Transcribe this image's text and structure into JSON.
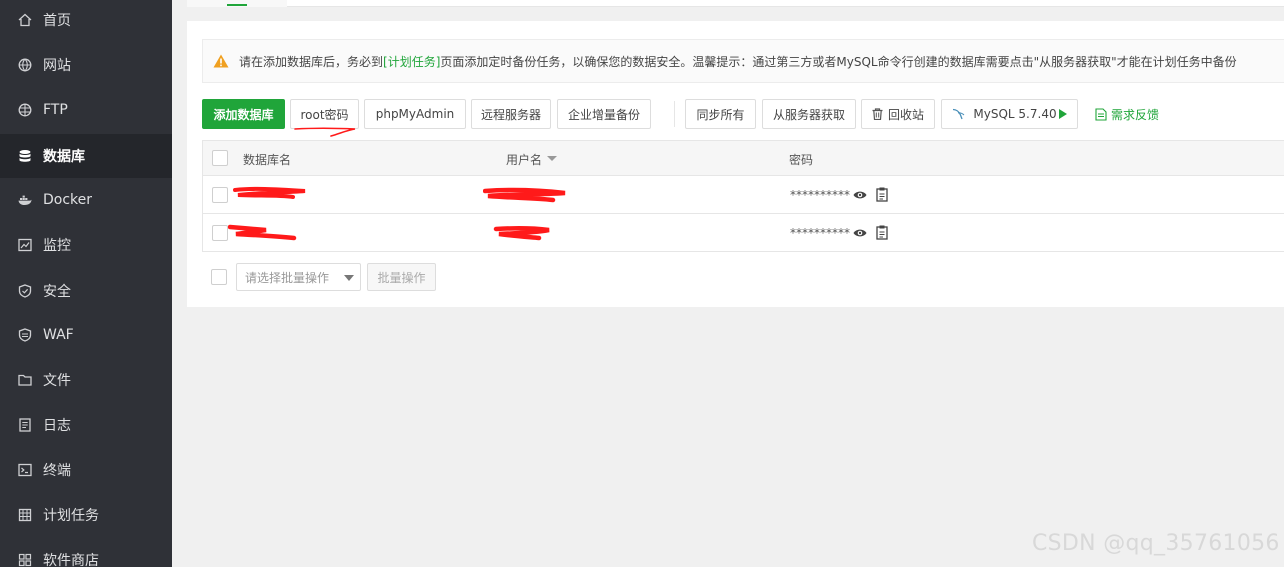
{
  "sidebar": {
    "items": [
      {
        "label": "首页",
        "icon": "home-icon"
      },
      {
        "label": "网站",
        "icon": "globe-icon"
      },
      {
        "label": "FTP",
        "icon": "ftp-globe-icon"
      },
      {
        "label": "数据库",
        "icon": "database-icon",
        "active": true
      },
      {
        "label": "Docker",
        "icon": "docker-icon"
      },
      {
        "label": "监控",
        "icon": "monitor-chart-icon"
      },
      {
        "label": "安全",
        "icon": "shield-check-icon"
      },
      {
        "label": "WAF",
        "icon": "waf-shield-icon"
      },
      {
        "label": "文件",
        "icon": "folder-icon"
      },
      {
        "label": "日志",
        "icon": "log-file-icon"
      },
      {
        "label": "终端",
        "icon": "terminal-icon"
      },
      {
        "label": "计划任务",
        "icon": "schedule-grid-icon"
      },
      {
        "label": "软件商店",
        "icon": "store-grid-icon"
      }
    ]
  },
  "notice": {
    "before": "请在添加数据库后，务必到",
    "link": "[计划任务]",
    "after": "页面添加定时备份任务，以确保您的数据安全。温馨提示：通过第三方或者MySQL命令行创建的数据库需要点击\"从服务器获取\"才能在计划任务中备份"
  },
  "toolbar": {
    "add_db": "添加数据库",
    "root_pw": "root密码",
    "phpmyadmin": "phpMyAdmin",
    "remote": "远程服务器",
    "enterprise_backup": "企业增量备份",
    "sync_all": "同步所有",
    "fetch_server": "从服务器获取",
    "recycle": "回收站",
    "mysql_version": "MySQL 5.7.40",
    "feedback": "需求反馈"
  },
  "table": {
    "headers": {
      "name": "数据库名",
      "user": "用户名",
      "password": "密码"
    },
    "rows": [
      {
        "password": "**********"
      },
      {
        "password": "**********"
      }
    ]
  },
  "batch": {
    "select_placeholder": "请选择批量操作",
    "button": "批量操作"
  },
  "watermark": "CSDN @qq_35761056",
  "colors": {
    "accent": "#20a53a",
    "sidebar": "#2f3137",
    "redaction": "#ff0000"
  }
}
